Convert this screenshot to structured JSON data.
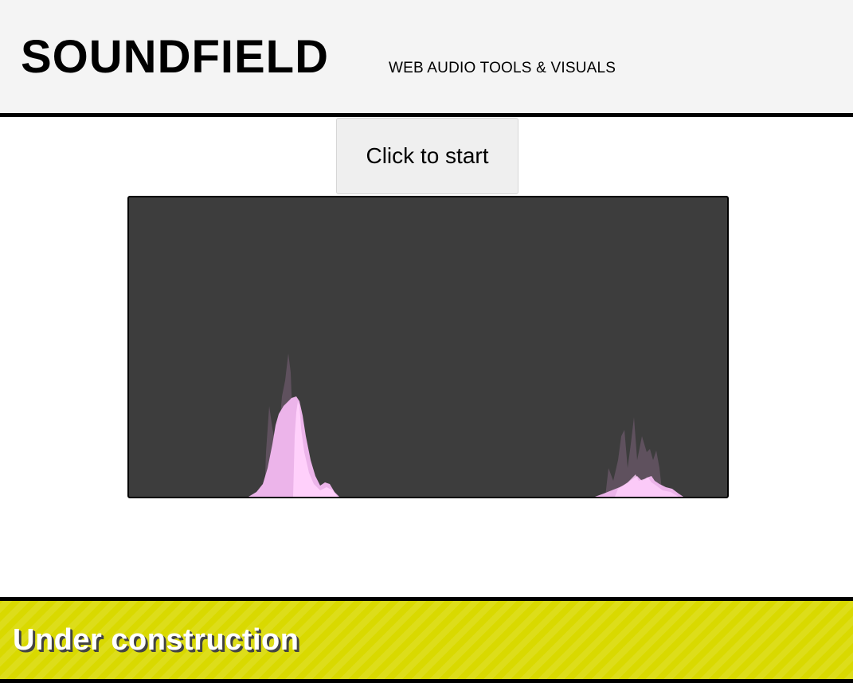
{
  "header": {
    "title": "SOUNDFIELD",
    "tagline": "WEB AUDIO TOOLS & VISUALS"
  },
  "controls": {
    "start_label": "Click to start"
  },
  "visualizer": {
    "background": "#3d3d3d",
    "fill_color": "#ecb4ea",
    "highlight_color": "#ffd0fb",
    "ghost_color": "#8a6a88"
  },
  "footer": {
    "notice": "Under construction",
    "background": "#d9d900"
  }
}
